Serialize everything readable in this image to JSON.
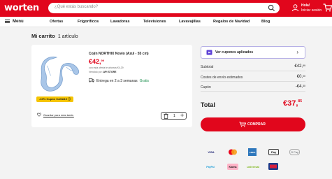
{
  "header": {
    "logo": "worten",
    "search_placeholder": "¿Qué estás buscando?",
    "user_hello": "Hola!",
    "user_login": "Iniciar sesión"
  },
  "nav": {
    "menu_label": "Menu",
    "items": [
      "Ofertas",
      "Frigoríficos",
      "Lavadoras",
      "Televisiones",
      "Lavavajillas",
      "Regalos de Navidad",
      "Blog"
    ]
  },
  "cart": {
    "title": "Mi carrito",
    "count": "1 artículo"
  },
  "product": {
    "title": "Cojín NORTHIX Novio (Azul - 55 cm)",
    "price_main": "€42,",
    "price_cents": "99",
    "offer_note": "con esta oferta te ahorras €4,29",
    "seller_label": "Vendido por:",
    "seller_name": "API STORE",
    "delivery": "Entrega en 2 a 3 semanas",
    "delivery_free": "Gratis",
    "coupon_badge": "-10% Cupón CASA10",
    "save_later": "Guardar para más tarde.",
    "quantity": "1"
  },
  "summary": {
    "coupons_label": "Ver cupones aplicados",
    "subtotal_label": "Subtotal",
    "subtotal_main": "€42,",
    "subtotal_cents": "99",
    "shipping_label": "Costes de envío estimados",
    "shipping_main": "€0,",
    "shipping_cents": "00",
    "coupon_label": "Cupón",
    "coupon_main": "-€4,",
    "coupon_cents": "30",
    "total_label": "Total",
    "total_main": "€37,",
    "total_cents": "85",
    "buy_label": "COMPRAR"
  },
  "payments": {
    "visa": "VISA",
    "mastercard": "",
    "amex": "AMEX",
    "applepay": "Pay",
    "gpay": "G Pay",
    "paypal": "PayPal",
    "klarna": "Klarna",
    "universal": "universal",
    "multibanco": ""
  },
  "colors": {
    "brand_red": "#e1061c",
    "coupon_yellow": "#f5c400",
    "coupons_border": "#b6b0e6",
    "free_green": "#1b8e4e"
  }
}
